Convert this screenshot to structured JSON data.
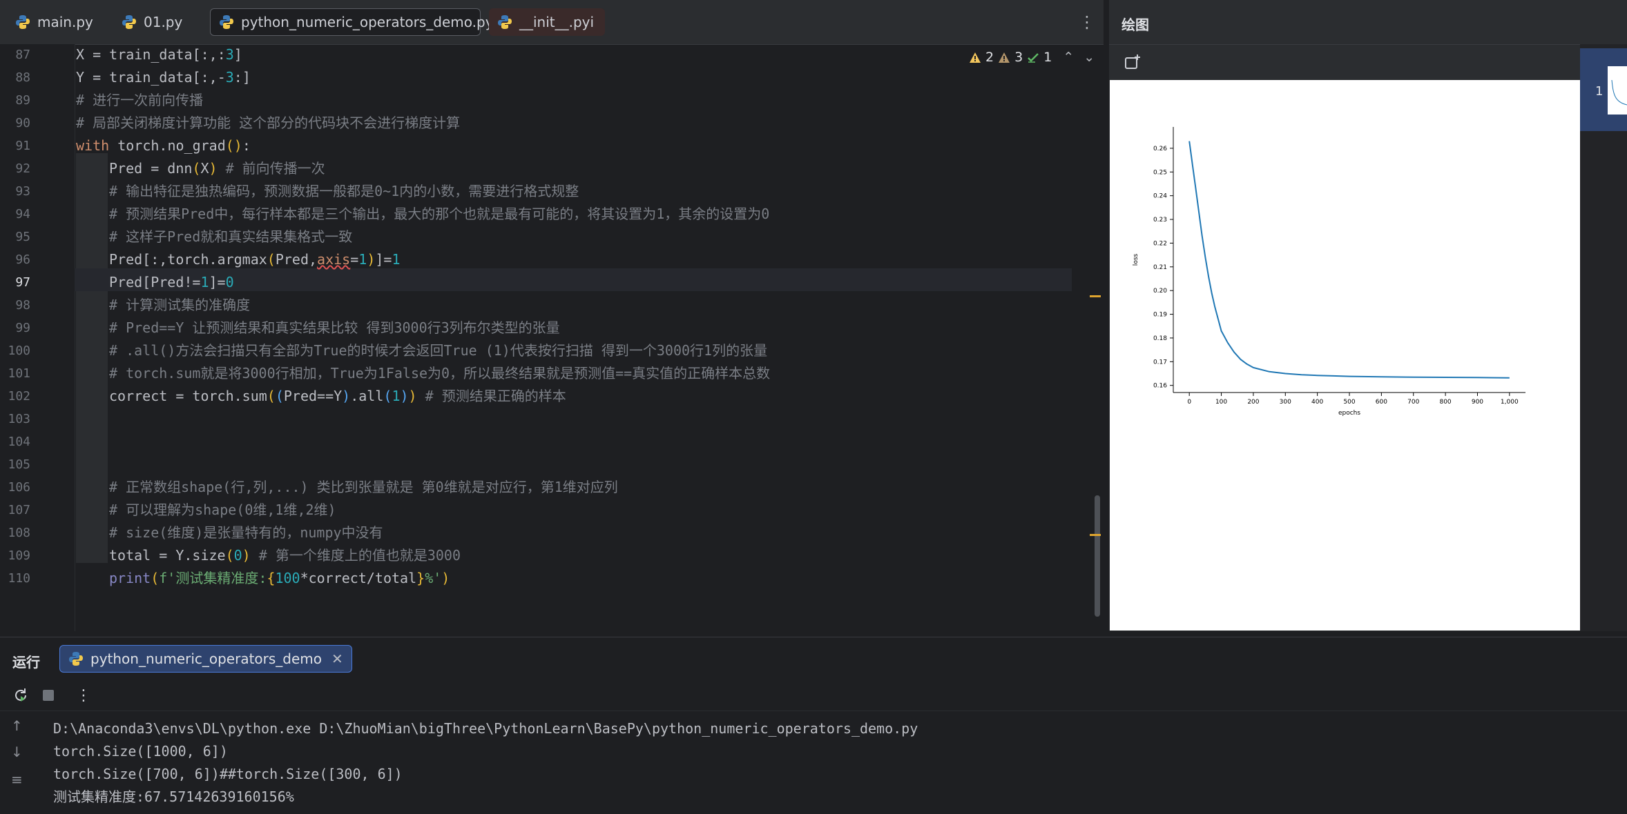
{
  "editor": {
    "tabs": [
      {
        "label": "main.py",
        "active": false
      },
      {
        "label": "01.py",
        "active": false
      },
      {
        "label": "python_numeric_operators_demo.py",
        "active": true
      },
      {
        "label": "__init__.pyi",
        "active": false
      }
    ],
    "more_icon": "kebab-menu-icon",
    "inspection": {
      "warnings": "2",
      "weak_warnings": "3",
      "typos": "1"
    },
    "current_line": "97",
    "line_numbers": [
      "87",
      "88",
      "89",
      "90",
      "91",
      "92",
      "93",
      "94",
      "95",
      "96",
      "97",
      "98",
      "99",
      "100",
      "101",
      "102",
      "103",
      "104",
      "105",
      "106",
      "107",
      "108",
      "109",
      "110"
    ],
    "code": {
      "l87": {
        "a": "X = train_data[:,:",
        "b": "3",
        "c": "]"
      },
      "l88": {
        "a": "Y = train_data[:,-",
        "b": "3",
        "c": ":]"
      },
      "l89": {
        "cmt": "# 进行一次前向传播"
      },
      "l90": {
        "cmt": "# 局部关闭梯度计算功能 这个部分的代码块不会进行梯度计算"
      },
      "l91": {
        "kw": "with",
        "a": " torch.no_grad",
        "p": "()",
        "c": ":"
      },
      "l92": {
        "a": "Pred = dnn",
        "p1": "(",
        "b": "X",
        "p2": ")",
        "cmt": " # 前向传播一次"
      },
      "l93": {
        "cmt": "# 输出特征是独热编码，预测数据一般都是0~1内的小数，需要进行格式规整"
      },
      "l94": {
        "cmt": "# 预测结果Pred中，每行样本都是三个输出，最大的那个也就是最有可能的，将其设置为1，其余的设置为0"
      },
      "l95": {
        "cmt": "# 这样子Pred就和真实结果集格式一致"
      },
      "l96": {
        "a": "Pred[:,torch.argmax",
        "p1": "(",
        "b": "Pred,",
        "kwarg": "axis",
        "eq": "=",
        "n": "1",
        "p2": ")",
        "c": "]=",
        "n2": "1"
      },
      "l97": {
        "a": "Pred[Pred!=",
        "n": "1",
        "c": "]=",
        "n2": "0"
      },
      "l98": {
        "cmt": "# 计算测试集的准确度"
      },
      "l99": {
        "cmt": "# Pred==Y 让预测结果和真实结果比较 得到3000行3列布尔类型的张量"
      },
      "l100": {
        "cmt": "# .all()方法会扫描只有全部为True的时候才会返回True (1)代表按行扫描 得到一个3000行1列的张量"
      },
      "l101": {
        "cmt": "# torch.sum就是将3000行相加，True为1False为0，所以最终结果就是预测值==真实值的正确样本总数"
      },
      "l102": {
        "a": "correct = torch.sum",
        "p1": "(",
        "p2": "(",
        "b": "Pred==Y",
        "p3": ")",
        "c": ".all",
        "p4": "(",
        "n": "1",
        "p5": ")",
        "p6": ")",
        "cmt": " # 预测结果正确的样本"
      },
      "l105": {
        "cmt": "# 正常数组shape(行,列,...) 类比到张量就是 第0维就是对应行，第1维对应列"
      },
      "l106": {
        "cmt": "# 可以理解为shape(0维,1维,2维)"
      },
      "l107": {
        "cmt": "# size(维度)是张量特有的，numpy中没有"
      },
      "l108": {
        "a": "total = Y.size",
        "p1": "(",
        "n": "0",
        "p2": ")",
        "cmt": " # 第一个维度上的值也就是3000"
      },
      "l109": {
        "fn": "print",
        "p1": "(",
        "s1": "f'测试集精准度:",
        "br1": "{",
        "n": "100",
        "b": "*correct/total",
        "br2": "}",
        "s2": "%'",
        "p2": ")"
      }
    }
  },
  "plot_window": {
    "title": "绘图",
    "thumbnail_index": "1",
    "new_window_icon": "open-in-new-window-icon"
  },
  "chart_data": {
    "type": "line",
    "title": "",
    "xlabel": "epochs",
    "ylabel": "loss",
    "xlim": [
      -50,
      1050
    ],
    "ylim": [
      0.157,
      0.269
    ],
    "x_ticks": [
      0,
      100,
      200,
      300,
      400,
      500,
      600,
      700,
      800,
      900,
      1000
    ],
    "x_tick_labels": [
      "0",
      "100",
      "200",
      "300",
      "400",
      "500",
      "600",
      "700",
      "800",
      "900",
      "1,000"
    ],
    "y_ticks": [
      0.16,
      0.17,
      0.18,
      0.19,
      0.2,
      0.21,
      0.22,
      0.23,
      0.24,
      0.25,
      0.26
    ],
    "y_tick_labels": [
      "0.16",
      "0.17",
      "0.18",
      "0.19",
      "0.20",
      "0.21",
      "0.22",
      "0.23",
      "0.24",
      "0.25",
      "0.26"
    ],
    "grid": false,
    "color": "#1f77b4",
    "series": [
      {
        "x": [
          0,
          10,
          20,
          30,
          40,
          50,
          60,
          70,
          80,
          90,
          100,
          120,
          140,
          160,
          180,
          200,
          250,
          300,
          350,
          400,
          450,
          500,
          600,
          700,
          800,
          900,
          1000
        ],
        "y": [
          0.263,
          0.253,
          0.243,
          0.233,
          0.223,
          0.214,
          0.206,
          0.199,
          0.193,
          0.188,
          0.183,
          0.178,
          0.174,
          0.171,
          0.169,
          0.1675,
          0.1658,
          0.165,
          0.1645,
          0.1642,
          0.164,
          0.1638,
          0.1636,
          0.1635,
          0.1634,
          0.1633,
          0.1632
        ]
      }
    ]
  },
  "run_panel": {
    "title": "运行",
    "config_tab": "python_numeric_operators_demo",
    "output": [
      "D:\\Anaconda3\\envs\\DL\\python.exe D:\\ZhuoMian\\bigThree\\PythonLearn\\BasePy\\python_numeric_operators_demo.py",
      "torch.Size([1000, 6])",
      "torch.Size([700, 6])##torch.Size([300, 6])",
      "测试集精准度:67.57142639160156%"
    ]
  }
}
